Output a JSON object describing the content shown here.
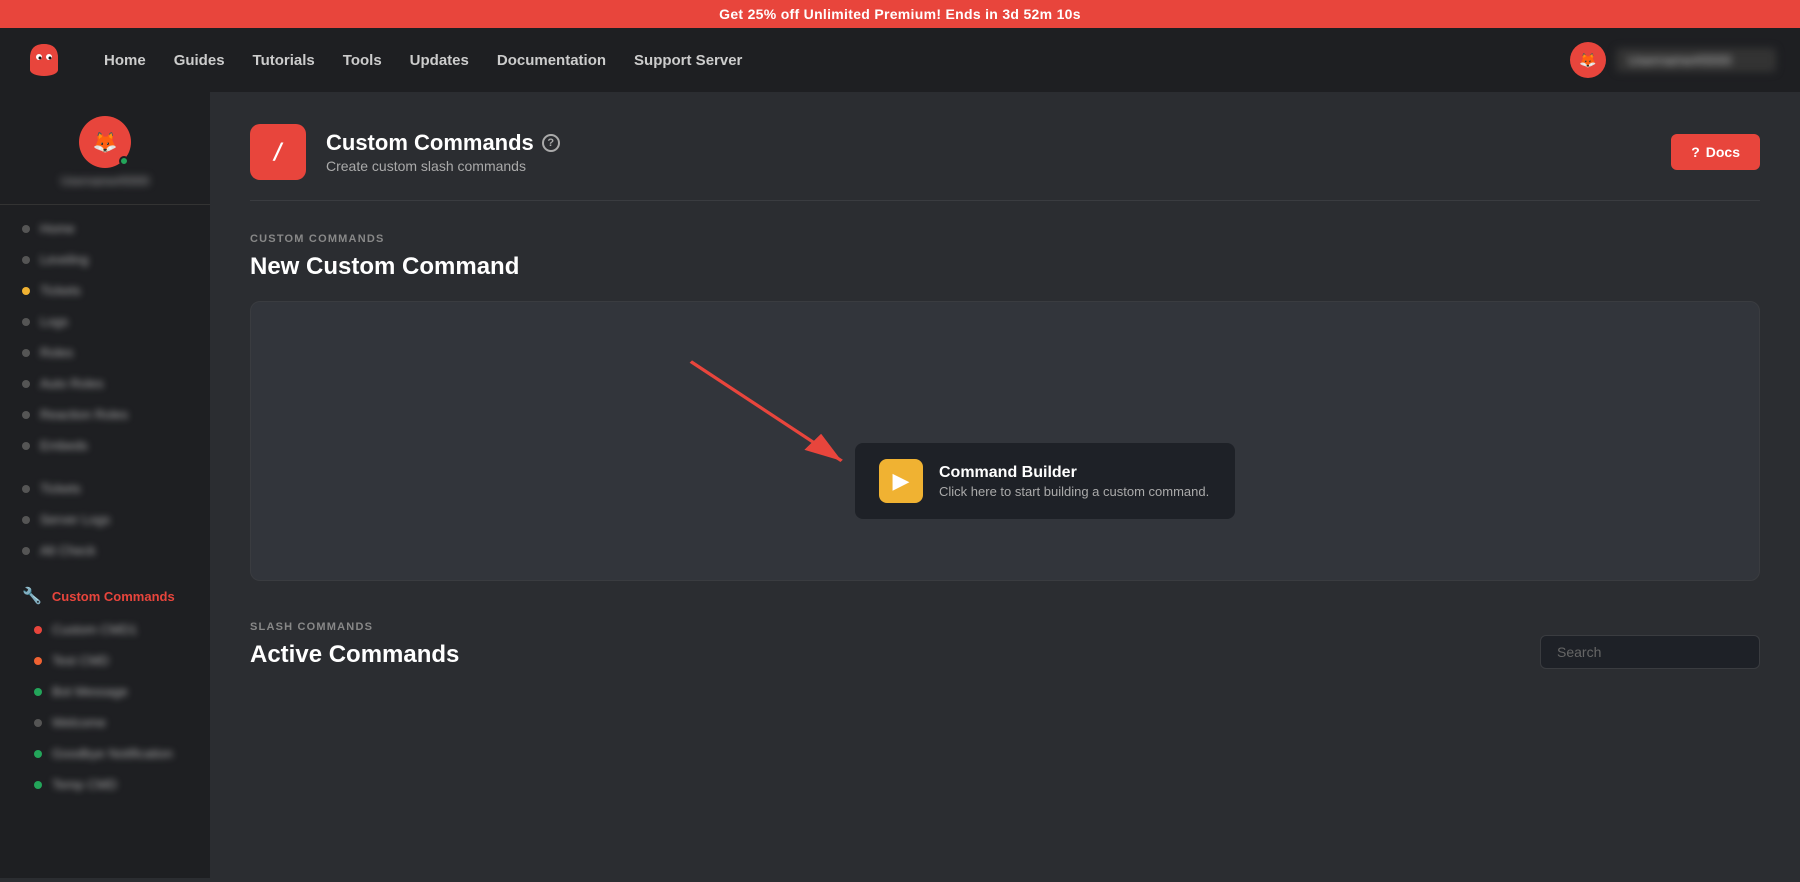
{
  "promo": {
    "text": "Get 25% off Unlimited Premium! Ends in 3d 52m 10s"
  },
  "navbar": {
    "links": [
      {
        "label": "Home",
        "name": "nav-home"
      },
      {
        "label": "Guides",
        "name": "nav-guides"
      },
      {
        "label": "Tutorials",
        "name": "nav-tutorials"
      },
      {
        "label": "Tools",
        "name": "nav-tools"
      },
      {
        "label": "Updates",
        "name": "nav-updates"
      },
      {
        "label": "Documentation",
        "name": "nav-documentation"
      },
      {
        "label": "Support Server",
        "name": "nav-support-server"
      }
    ],
    "username": "Username#0000"
  },
  "sidebar": {
    "items_top": [
      {
        "label": "Home",
        "dot": "default"
      },
      {
        "label": "Leveling",
        "dot": "default"
      },
      {
        "label": "Tickets",
        "dot": "yellow"
      },
      {
        "label": "Logs",
        "dot": "default"
      },
      {
        "label": "Roles",
        "dot": "default"
      },
      {
        "label": "Auto Roles",
        "dot": "default"
      },
      {
        "label": "Reaction Roles",
        "dot": "default"
      },
      {
        "label": "Embeds",
        "dot": "default"
      }
    ],
    "items_bottom": [
      {
        "label": "Tickets",
        "dot": "default"
      },
      {
        "label": "Server Logs",
        "dot": "default"
      },
      {
        "label": "Alt Check",
        "dot": "default"
      }
    ],
    "custom_commands": {
      "label": "Custom Commands",
      "active": true,
      "sub_items": [
        {
          "label": "Custom CMD1",
          "dot": "red"
        },
        {
          "label": "Test CMD",
          "dot": "orange"
        },
        {
          "label": "Bot Message",
          "dot": "green"
        },
        {
          "label": "Welcome",
          "dot": "default"
        },
        {
          "label": "Goodbye Notification",
          "dot": "green"
        },
        {
          "label": "Temp CMD",
          "dot": "green"
        }
      ]
    }
  },
  "page": {
    "icon_label": "/",
    "title": "Custom Commands",
    "subtitle": "Create custom slash commands",
    "docs_button": "Docs",
    "section_label": "CUSTOM COMMANDS",
    "section_title": "New Custom Command",
    "builder": {
      "card_title": "Command Builder",
      "card_subtitle": "Click here to start building a custom command.",
      "icon": "▶"
    },
    "slash_section": {
      "label": "SLASH COMMANDS",
      "title": "Active Commands",
      "search_placeholder": "Search"
    }
  }
}
